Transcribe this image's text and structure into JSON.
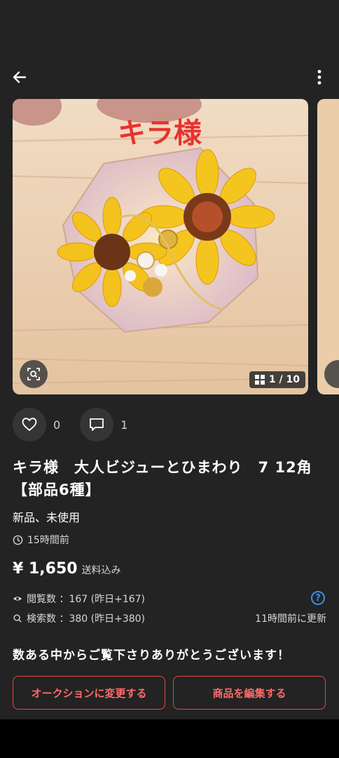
{
  "gallery": {
    "overlay_text": "キラ様",
    "counter": "1 / 10"
  },
  "icons": {
    "back": "arrow-left-icon",
    "more": "more-vertical-icon",
    "lens": "image-search-icon",
    "grid": "grid-icon",
    "like": "heart-icon",
    "comment": "comment-icon",
    "clock": "clock-icon",
    "eye": "eye-icon",
    "search": "search-icon",
    "help": "help-icon"
  },
  "stats": {
    "likes": "0",
    "comments": "1",
    "views": "閲覧数 ：167 (昨日+167)",
    "searches": "検索数 ：380 (昨日+380)",
    "updated": "11時間前に更新"
  },
  "item": {
    "title": "キラ様　大人ビジューとひまわり　7 12角【部品6種】",
    "condition": "新品、未使用",
    "posted": "15時間前",
    "price": "¥ 1,650",
    "shipping": "送料込み"
  },
  "message": "数ある中からご覧下さりありがとうございます！",
  "buttons": {
    "auction": "オークションに変更する",
    "edit": "商品を編集する"
  },
  "colors": {
    "background": "#232323",
    "accent_red": "#e04a4a",
    "help_blue": "#3a8ee6"
  }
}
